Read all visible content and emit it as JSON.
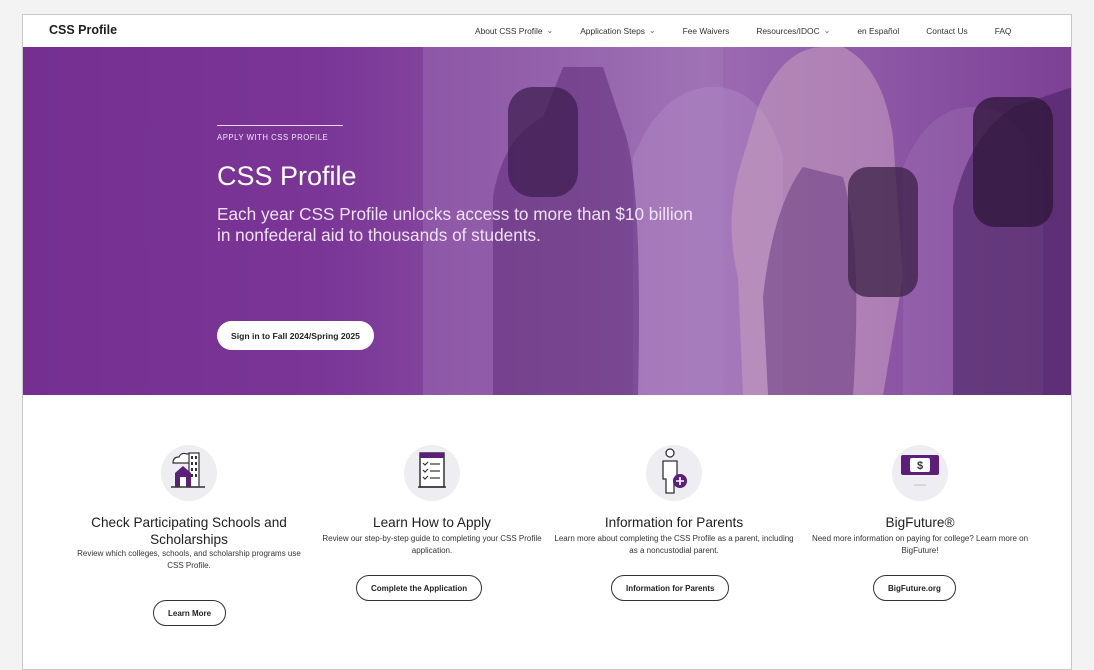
{
  "header": {
    "logo": "CSS Profile",
    "nav": [
      {
        "label": "About CSS Profile",
        "has_dropdown": true
      },
      {
        "label": "Application Steps",
        "has_dropdown": true
      },
      {
        "label": "Fee Waivers",
        "has_dropdown": false
      },
      {
        "label": "Resources/IDOC",
        "has_dropdown": true
      },
      {
        "label": "en Español",
        "has_dropdown": false
      },
      {
        "label": "Contact Us",
        "has_dropdown": false
      },
      {
        "label": "FAQ",
        "has_dropdown": false
      }
    ]
  },
  "hero": {
    "eyebrow": "APPLY WITH CSS PROFILE",
    "title": "CSS Profile",
    "subtitle": "Each year CSS Profile unlocks access to more than $10 billion in nonfederal aid to thousands of students.",
    "cta_label": "Sign in to Fall 2024/Spring 2025",
    "overlay_color": "#7a3596"
  },
  "cards": [
    {
      "icon": "school-building-icon",
      "title": "Check Participating Schools and Scholarships",
      "description": "Review which colleges, schools, and scholarship programs use CSS Profile.",
      "button": "Learn More"
    },
    {
      "icon": "checklist-icon",
      "title": "Learn How to Apply",
      "description": "Review our step-by-step guide to completing your CSS Profile application.",
      "button": "Complete the Application"
    },
    {
      "icon": "parent-add-icon",
      "title": "Information for Parents",
      "description": "Learn more about completing the CSS Profile as a parent, including as a noncustodial parent.",
      "button": "Information for Parents"
    },
    {
      "icon": "dollar-bill-icon",
      "title": "BigFuture®",
      "description": "Need more information on paying for college? Learn more on BigFuture!",
      "button": "BigFuture.org"
    }
  ],
  "colors": {
    "brand_purple": "#742f91",
    "icon_purple": "#5b1f7a",
    "icon_circle": "#e8e8ef",
    "text_dark": "#1e1e1e"
  }
}
